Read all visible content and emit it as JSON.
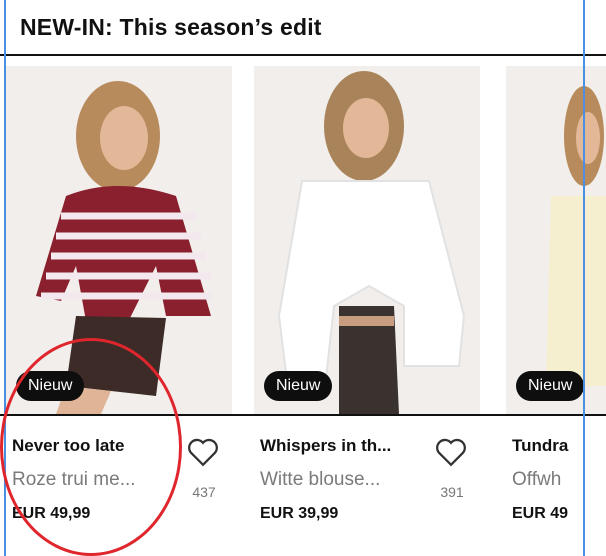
{
  "header": {
    "title": "NEW-IN: This season’s edit"
  },
  "products": [
    {
      "badge": "Nieuw",
      "name": "Never too late",
      "description": "Roze trui me...",
      "price": "EUR 49,99",
      "likes": "437"
    },
    {
      "badge": "Nieuw",
      "name": "Whispers in th...",
      "description": "Witte blouse...",
      "price": "EUR 39,99",
      "likes": "391"
    },
    {
      "badge": "Nieuw",
      "name": "Tundra",
      "description": "Offwh",
      "price": "EUR 49",
      "likes": ""
    }
  ],
  "colors": {
    "accent_circle": "#e0262d",
    "guide_line": "#4a90e2",
    "badge_bg": "#0e0e0e"
  }
}
